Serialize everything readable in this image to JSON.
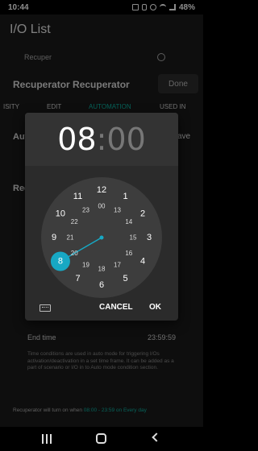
{
  "status_bar": {
    "time": "10:44",
    "battery": "48%"
  },
  "app": {
    "title": "I/O List",
    "search_placeholder": "Recuper",
    "device_name": "Recuperator Recuperator",
    "done_label": "Done",
    "tabs": [
      "ISITY",
      "EDIT",
      "AUTOMATION",
      "USED IN"
    ],
    "auto_label": "Auto",
    "save_label": "ave",
    "rec_label": "Rec",
    "end_time_label": "End time",
    "end_time_value": "23:59:59",
    "info_text": "Time conditions are used in auto mode for triggering I/Os activation/deactivation in a set time frame. It can be added as a part of scenario or I/O in to Auto mode condition section.",
    "footer_prefix": "Recuperator will turn on when ",
    "footer_highlight": "08:00 - 23:59 on Every day"
  },
  "dialog": {
    "hour": "08",
    "colon": ":",
    "minute": "00",
    "cancel_label": "CANCEL",
    "ok_label": "OK",
    "outer_numbers": [
      "12",
      "1",
      "2",
      "3",
      "4",
      "5",
      "6",
      "7",
      "8",
      "9",
      "10",
      "11"
    ],
    "inner_numbers": [
      "00",
      "13",
      "14",
      "15",
      "16",
      "17",
      "18",
      "19",
      "20",
      "21",
      "22",
      "23"
    ],
    "selected_hour": "8",
    "accent_color": "#17a8c4"
  }
}
